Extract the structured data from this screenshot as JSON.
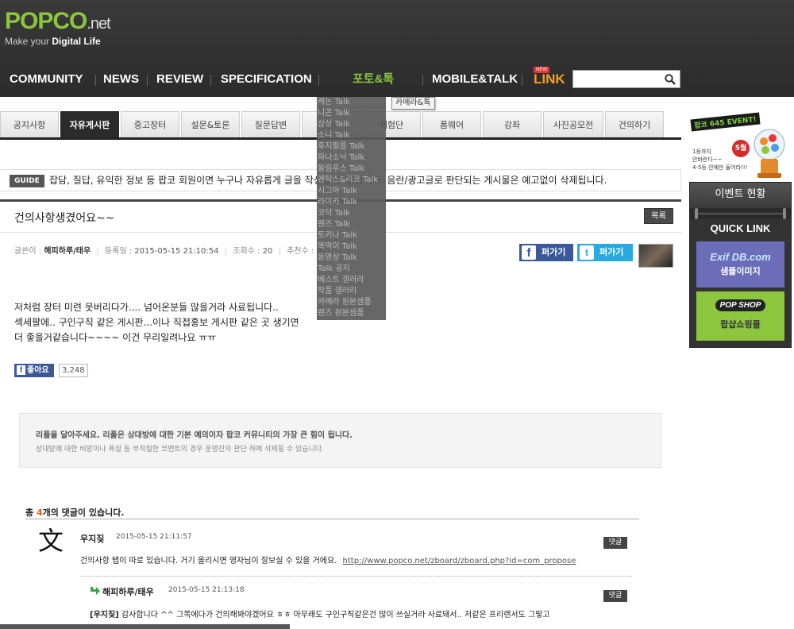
{
  "logo": {
    "brand": "POPCO",
    "tld": ".net",
    "tagline_plain": "Make your ",
    "tagline_bold": "Digital Life"
  },
  "nav": {
    "items": [
      "COMMUNITY",
      "NEWS",
      "REVIEW",
      "SPECIFICATION",
      "포토&톡",
      "MOBILE&TALK",
      "LINK"
    ],
    "new_badge": "NEW"
  },
  "search": {
    "placeholder": ""
  },
  "subnav": {
    "tabs": [
      "공지사항",
      "자유게시판",
      "중고장터",
      "설문&토론",
      "질문답변",
      "유",
      "체험단",
      "폼웨어",
      "강좌",
      "사진공모전",
      "건의하기"
    ]
  },
  "dropdown": {
    "items": [
      "캐논 Talk",
      "니콘 Talk",
      "삼성 Talk",
      "소니 Talk",
      "후지필름 Talk",
      "파나소닉 Talk",
      "올림푸스 Talk",
      "펜탁스&리코 Talk",
      "시그마 Talk",
      "라이카 Talk",
      "코닥 Talk",
      "렌즈 Talk",
      "토키나 Talk",
      "똑딱이 Talk",
      "동영상 Talk",
      "Talk 공지",
      "베스트 갤러리",
      "작품 갤러리",
      "카메라 원본샘플",
      "렌즈 원본샘플"
    ],
    "tooltip": "카메라&톡"
  },
  "guide": {
    "label": "GUIDE",
    "text": "잡담, 질답, 유익한 정보 등 팝코 회원이면 누구나 자유롭게 글을 작성할 수 있습니다. 음란/광고글로 판단되는 게시물은 예고없이 삭제됩니다."
  },
  "post": {
    "title": "건의사항생겼어요~~",
    "list_button": "목록",
    "meta": {
      "author_label": "글쓴이 :",
      "author": "해피하루/태우",
      "date_label": "등록일 :",
      "date": "2015-05-15 21:10:54",
      "views_label": "조회수 :",
      "views": "20",
      "recommend_label": "추천수 :",
      "recommend": "0"
    },
    "share_fb": "퍼가기",
    "share_tw": "퍼가기",
    "body": [
      "저처럼 장터 미련 못버리다가.... 넘어온분들 많을거라 사료됩니다..",
      "섹세팔에.. 구인구직 같은 게시판...이나 직접홍보 게시판 같은 곳 생기면",
      "더 좋을거같습니다~~~~ 이건 무리일려나요 ㅠㅠ"
    ],
    "like_label": "좋아요",
    "like_count": "3,248"
  },
  "notice": {
    "line1": "리플을 달아주세요. 리플은 상대방에 대한 기본 예의이자 팝코 커뮤니티의 가장 큰 힘이 됩니다.",
    "line2": "상대방에 대한 비방이나 욕설 등 부적절한 코멘트의 경우 운영진의 판단 하에 삭제될 수 있습니다."
  },
  "comments": {
    "count_prefix": "총 ",
    "count": "4",
    "count_suffix": "개의 댓글이 있습니다.",
    "reply_label": "댓글",
    "first": {
      "author": "우지짖",
      "date": "2015-05-15 21:11:57",
      "text": "건의사항 탭이 따로 있습니다. 거기 올리시면 영자님이 잘보실 수 있을 거에요.",
      "url": "http://www.popco.net/zboard/zboard.php?id=com_propose"
    },
    "reply": {
      "author": "해피하루/태우",
      "date": "2015-05-15 21:13:18",
      "tag": "[우지짖]",
      "text": "감사합니다 ^^ 그쪽에다가 건의해봐야겠어요 ㅎㅎ 아무래도 구인구직같은건 많이 쓰실거라 사료돼서.. 저같은 프리랜서도 그렇고"
    }
  },
  "sidebar": {
    "event_title": "팝코 645 EVENT!",
    "event_text": [
      "1등까지",
      "안바란다~~",
      "4-5등 안에만 들어라!!!"
    ],
    "event_month": "5월",
    "event_button": "이벤트 현황",
    "quick_link": "QUICK LINK",
    "exif_title": "Exif DB.com",
    "exif_sub": "샘플이미지",
    "popshop_logo": "POP SHOP",
    "popshop_sub": "팝샵쇼핑몰"
  },
  "colors": {
    "accent_green": "#8cc63f",
    "link_orange": "#f6a01a",
    "dark": "#2b2b2b"
  }
}
